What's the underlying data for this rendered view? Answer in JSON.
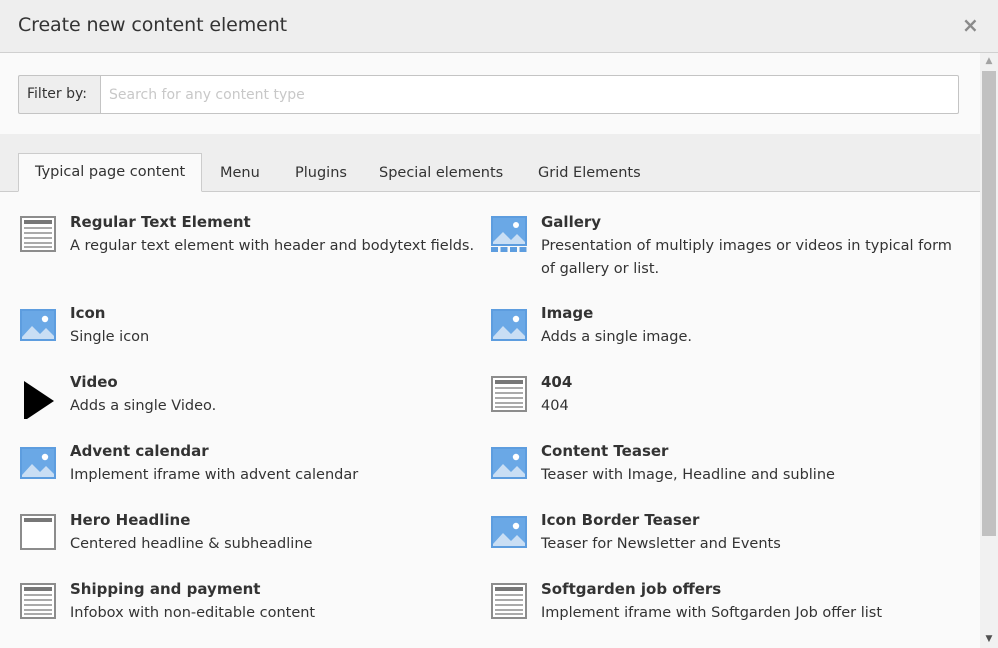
{
  "header": {
    "title": "Create new content element",
    "close": "×"
  },
  "filter": {
    "label": "Filter by:",
    "placeholder": "Search for any content type",
    "value": ""
  },
  "tabs": [
    {
      "label": "Typical page content",
      "active": true
    },
    {
      "label": "Menu",
      "active": false
    },
    {
      "label": "Plugins",
      "active": false
    },
    {
      "label": "Special elements",
      "active": false
    },
    {
      "label": "Grid Elements",
      "active": false
    }
  ],
  "elements": [
    {
      "name": "Regular Text Element",
      "desc": "A regular text element with header and bodytext fields.",
      "icon": "text-icon"
    },
    {
      "name": "Gallery",
      "desc": "Presentation of multiply images or videos in typical form of gallery or list.",
      "icon": "gallery-icon"
    },
    {
      "name": "Icon",
      "desc": "Single icon",
      "icon": "image-icon"
    },
    {
      "name": "Image",
      "desc": "Adds a single image.",
      "icon": "image-icon"
    },
    {
      "name": "Video",
      "desc": "Adds a single Video.",
      "icon": "play-icon"
    },
    {
      "name": "404",
      "desc": "404",
      "icon": "text-icon"
    },
    {
      "name": "Advent calendar",
      "desc": "Implement iframe with advent calendar",
      "icon": "image-icon"
    },
    {
      "name": "Content Teaser",
      "desc": "Teaser with Image, Headline and subline",
      "icon": "image-icon"
    },
    {
      "name": "Hero Headline",
      "desc": "Centered headline & subheadline",
      "icon": "header-icon"
    },
    {
      "name": "Icon Border Teaser",
      "desc": "Teaser for Newsletter and Events",
      "icon": "image-icon"
    },
    {
      "name": "Shipping and payment",
      "desc": "Infobox with non-editable content",
      "icon": "text-icon"
    },
    {
      "name": "Softgarden job offers",
      "desc": "Implement iframe with Softgarden Job offer list",
      "icon": "text-icon"
    }
  ],
  "colors": {
    "icon_blue": "#5d9ddf",
    "icon_grey": "#8c8c8c",
    "header_bg": "#eeeeee"
  }
}
